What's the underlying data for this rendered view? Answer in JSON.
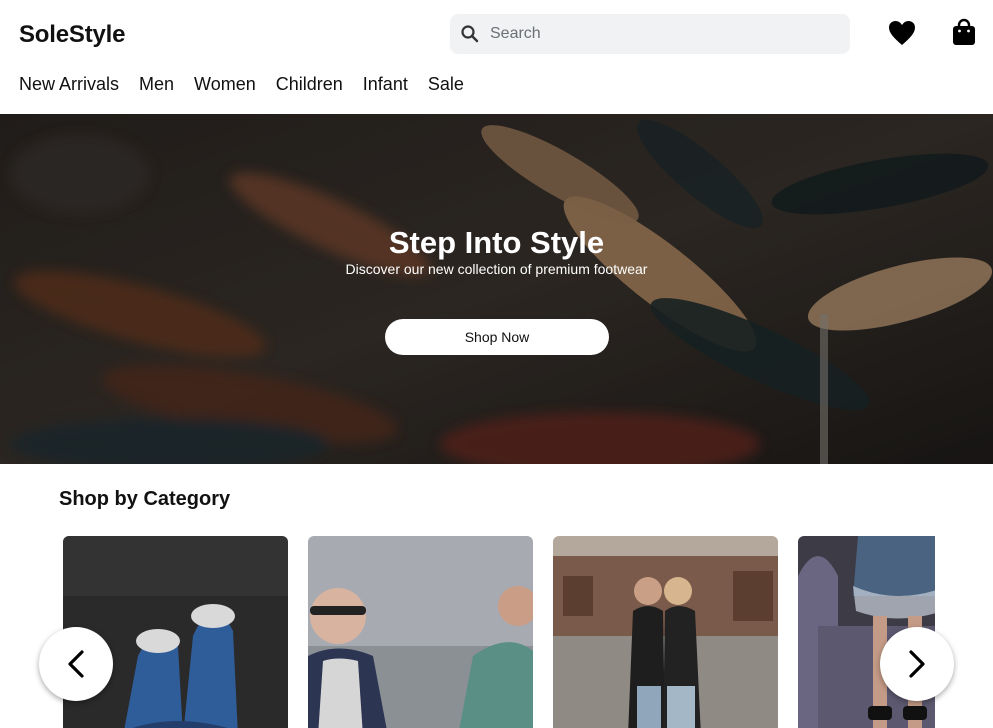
{
  "header": {
    "logo": "SoleStyle",
    "search": {
      "placeholder": "Search",
      "value": ""
    },
    "icons": [
      "search-icon",
      "heart-icon",
      "shopping-bag-icon"
    ]
  },
  "nav": {
    "items": [
      {
        "label": "New Arrivals"
      },
      {
        "label": "Men"
      },
      {
        "label": "Women"
      },
      {
        "label": "Children"
      },
      {
        "label": "Infant"
      },
      {
        "label": "Sale"
      }
    ]
  },
  "hero": {
    "title": "Step Into Style",
    "subtitle": "Discover our new collection of premium footwear",
    "cta_label": "Shop Now"
  },
  "categories": {
    "title": "Shop by Category",
    "cards": [
      {
        "image": "blue sneakers photo"
      },
      {
        "image": "smiling man photo"
      },
      {
        "image": "two women photo"
      },
      {
        "image": "seated person photo"
      }
    ],
    "prev_icon": "chevron-left-icon",
    "next_icon": "chevron-right-icon"
  },
  "colors": {
    "text": "#111111",
    "search_bg": "#f1f2f4",
    "hero_overlay": "#2a2522",
    "button_bg": "#ffffff"
  }
}
